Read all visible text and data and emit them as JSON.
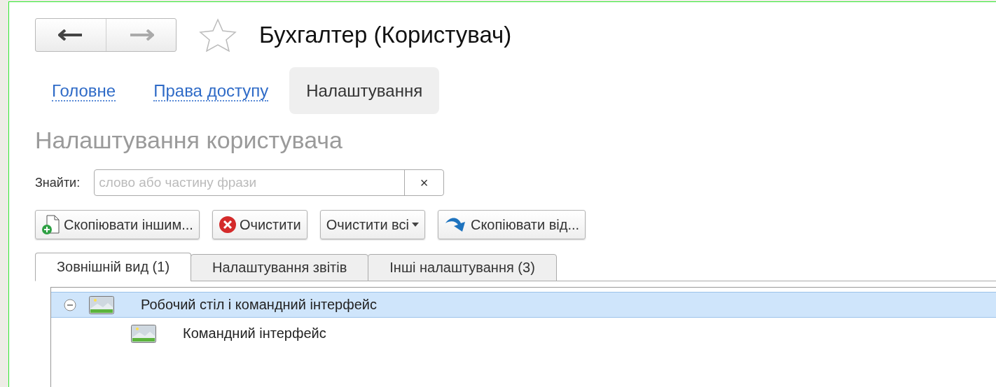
{
  "window": {
    "title": "Бухгалтер (Користувач)",
    "favorite": false
  },
  "nav_tabs": [
    {
      "label": "Головне",
      "selected": false
    },
    {
      "label": "Права доступу",
      "selected": false
    },
    {
      "label": "Налаштування",
      "selected": true
    }
  ],
  "heading": "Налаштування користувача",
  "search": {
    "label": "Знайти:",
    "placeholder": "слово або частину фрази",
    "clear": "×"
  },
  "buttons": [
    {
      "kind": "copy-to",
      "label": "Скопіювати іншим..."
    },
    {
      "kind": "clear",
      "label": "Очистити"
    },
    {
      "kind": "menu",
      "label": "Очистити всі"
    },
    {
      "kind": "copy-from",
      "label": "Скопіювати від..."
    }
  ],
  "tabs": [
    {
      "label": "Зовнішній вид (1)",
      "selected": true
    },
    {
      "label": "Налаштування звітів",
      "selected": false
    },
    {
      "label": "Інші налаштування (3)",
      "selected": false
    }
  ],
  "tree": [
    {
      "label": "Робочий стіл і командний інтерфейс",
      "selected": true,
      "expanded": true,
      "children": [
        {
          "label": "Командний інтерфейс",
          "selected": false
        }
      ]
    }
  ]
}
